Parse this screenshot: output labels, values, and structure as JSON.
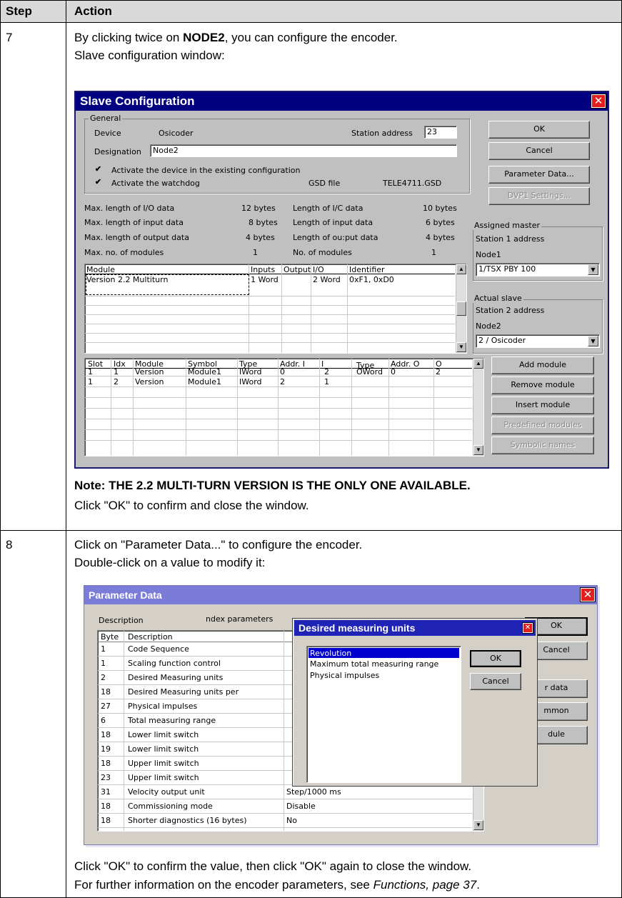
{
  "table": {
    "header_step": "Step",
    "header_action": "Action"
  },
  "step7": {
    "number": "7",
    "line1_pre": "By clicking twice on ",
    "line1_bold": "NODE2",
    "line1_post": ", you can configure the encoder.",
    "line2": "Slave configuration window:",
    "note": "Note: THE 2.2 MULTI-TURN VERSION IS THE ONLY ONE AVAILABLE.",
    "confirm": "Click \"OK\" to confirm and close the window."
  },
  "slave": {
    "title": "Slave Configuration",
    "general_label": "General",
    "device_label": "Device",
    "device_value": "Osicoder",
    "station_label": "Station address",
    "station_value": "23",
    "designation_label": "Designation",
    "designation_value": "Node2",
    "activate_device": "Activate the device in the existing configuration",
    "activate_watchdog": "Activate the watchdog",
    "gsd_label": "GSD file",
    "gsd_value": "TELE4711.GSD",
    "buttons": {
      "ok": "OK",
      "cancel": "Cancel",
      "param": "Parameter  Data...",
      "dvp1": "DVP1  Settings..."
    },
    "stats": [
      {
        "label": "Max. length of I/O data",
        "value": "12  bytes",
        "label2": "Length of I/C data",
        "value2": "10  bytes"
      },
      {
        "label": "Max. length of input data",
        "value": "8 bytes",
        "label2": "Length of input data",
        "value2": "6  bytes"
      },
      {
        "label": "Max. length of output data",
        "value": "4  bytes",
        "label2": "Length of ou:put data",
        "value2": "4  bytes"
      },
      {
        "label": "Max. no. of modules",
        "value": "1",
        "label2": "No. of modules",
        "value2": "1"
      }
    ],
    "assigned_master_label": "Assigned master",
    "station1": "Station 1 address",
    "node1": "Node1",
    "master_select": "1/TSX PBY 100",
    "actual_slave_label": "Actual slave",
    "station2": "Station 2 address",
    "node2": "Node2",
    "slave_select": "2 / Osicoder",
    "module_table": {
      "headers": [
        "Module",
        "Inputs",
        "Output",
        "I/O",
        "Identifier"
      ],
      "row": [
        "Version 2.2 Multiturn",
        "1 Word",
        "",
        "2 Word",
        "0xF1, 0xD0"
      ]
    },
    "slot_table": {
      "headers": [
        "Slot",
        "Idx",
        "Module",
        "Symbol",
        "Type",
        "Addr. I",
        "I",
        "Type",
        "Addr. O",
        "O"
      ],
      "rows": [
        [
          "1",
          "1",
          "Version",
          "Module1",
          "IWord",
          "0",
          "2",
          "OWord",
          "0",
          "2"
        ],
        [
          "1",
          "2",
          "Version",
          "Module1",
          "IWord",
          "2",
          "1",
          "",
          "",
          ""
        ]
      ]
    },
    "right_buttons": {
      "add": "Add  module",
      "remove": "Remove   module",
      "insert": "Insert  module",
      "predefined": "Predefined   modules",
      "symbolic": "Symbolic  names"
    }
  },
  "step8": {
    "number": "8",
    "line1": "Click on \"Parameter Data...\" to configure the encoder.",
    "line2": "Double-click on a value to modify it:",
    "footer1": "Click \"OK\" to confirm the value, then click \"OK\" again to close the window.",
    "footer2_pre": "For further information on the encoder parameters, see ",
    "footer2_ital": "Functions, page 37",
    "footer2_post": "."
  },
  "param": {
    "title": "Parameter Data",
    "description_label": "Description",
    "index_params": "ndex parameters",
    "col_byte": "Byte",
    "col_desc": "Description",
    "rows": [
      {
        "byte": "1",
        "desc": "Code Sequence",
        "value": ""
      },
      {
        "byte": "1",
        "desc": "Scaling function control",
        "value": ""
      },
      {
        "byte": "2",
        "desc": "Desired Measuring units",
        "value": ""
      },
      {
        "byte": "18",
        "desc": "Desired Measuring units per",
        "value": ""
      },
      {
        "byte": "27",
        "desc": "Physical impulses",
        "value": ""
      },
      {
        "byte": "6",
        "desc": "Total measuring range",
        "value": ""
      },
      {
        "byte": "18",
        "desc": "Lower limit switch",
        "value": ""
      },
      {
        "byte": "19",
        "desc": "Lower limit switch",
        "value": ""
      },
      {
        "byte": "18",
        "desc": "Upper limit switch",
        "value": ""
      },
      {
        "byte": "23",
        "desc": "Upper limit switch",
        "value": ""
      },
      {
        "byte": "31",
        "desc": "Velocity output unit",
        "value": "Step/1000 ms"
      },
      {
        "byte": "18",
        "desc": "Commissioning mode",
        "value": "Disable"
      },
      {
        "byte": "18",
        "desc": "Shorter diagnostics (16 bytes)",
        "value": "No"
      }
    ],
    "buttons": {
      "ok": "OK",
      "cancel": "Cancel",
      "data": "r  data",
      "common": "mmon",
      "module": "dule"
    }
  },
  "measure": {
    "title": "Desired measuring units",
    "options": [
      "Revolution",
      "Maximum total measuring range",
      "Physical impulses"
    ],
    "ok": "OK",
    "cancel": "Cancel"
  }
}
